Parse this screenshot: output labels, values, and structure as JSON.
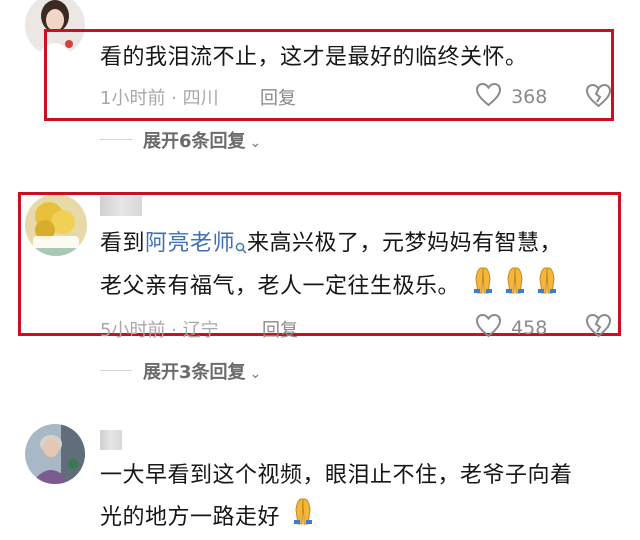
{
  "comments": [
    {
      "text": "看的我泪流不止，这才是最好的临终关怀。",
      "meta": "1小时前 · 四川",
      "reply_label": "回复",
      "likes": "368",
      "expand_label": "展开6条回复"
    },
    {
      "text_part1": "看到",
      "mention": "阿亮老师",
      "text_part2": "来高兴极了，元梦妈妈有智慧，",
      "text_line2": "老父亲有福气，老人一定往生极乐。",
      "meta": "5小时前 · 辽宁",
      "reply_label": "回复",
      "likes": "458",
      "expand_label": "展开3条回复"
    },
    {
      "text_line1": "一大早看到这个视频，眼泪止不住，老爷子向着",
      "text_line2": "光的地方一路走好"
    }
  ],
  "icons": {
    "like": "heart-outline-icon",
    "dislike": "broken-heart-icon",
    "chevron": "chevron-down-icon",
    "emoji": "folded-hands-emoji"
  },
  "colors": {
    "highlight_box": "#c8101f",
    "mention": "#3f6fb5",
    "meta_text": "#a8a8a8"
  }
}
